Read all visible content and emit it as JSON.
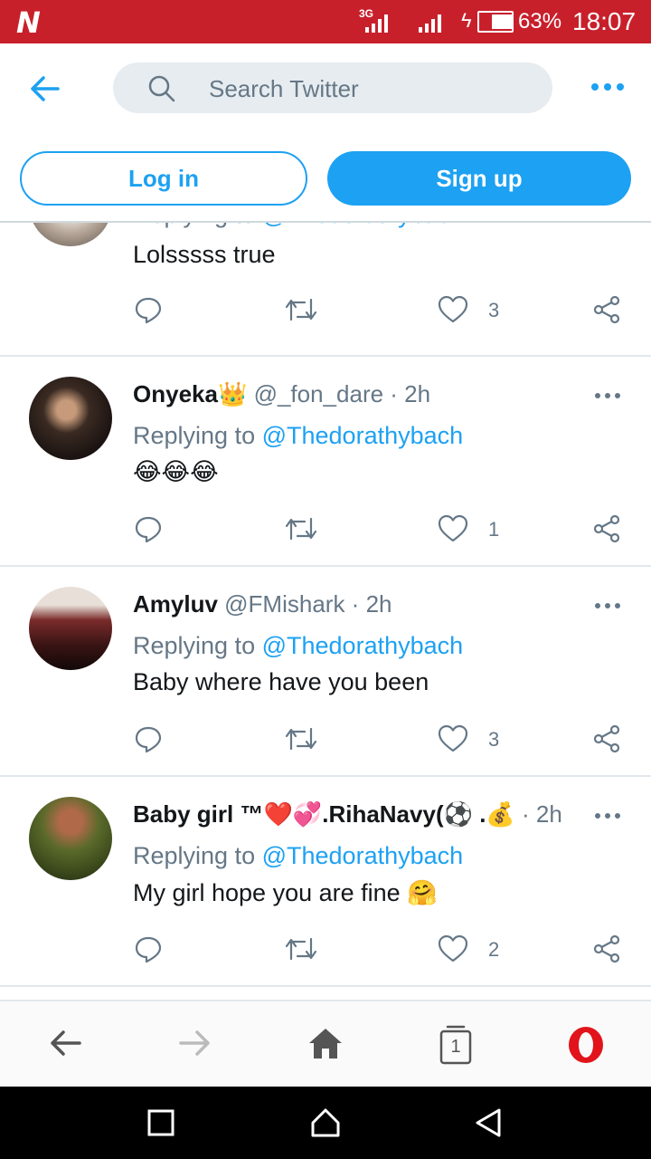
{
  "status_bar": {
    "network": "3G",
    "battery_percent": "63%",
    "time": "18:07"
  },
  "header": {
    "search_placeholder": "Search Twitter",
    "login_label": "Log in",
    "signup_label": "Sign up"
  },
  "tweets": [
    {
      "replying_prefix": "Replying to",
      "replying_handle": "@Thedorathybach",
      "text": "Lolsssss true",
      "likes": "3"
    },
    {
      "name": "Onyeka",
      "name_emoji": "👑",
      "handle": "@_fon_dare",
      "time": "2h",
      "replying_prefix": "Replying to",
      "replying_handle": "@Thedorathybach",
      "text": "😂😂😂",
      "likes": "1"
    },
    {
      "name": "Amyluv",
      "handle": "@FMishark",
      "time": "2h",
      "replying_prefix": "Replying to",
      "replying_handle": "@Thedorathybach",
      "text": "Baby where have you been",
      "likes": "3"
    },
    {
      "name": "Baby girl ™❤️💞.RihaNavy(⚽ .💰",
      "time": "2h",
      "replying_prefix": "Replying to",
      "replying_handle": "@Thedorathybach",
      "text": "My girl hope you are fine 🤗",
      "likes": "2"
    }
  ],
  "browser_nav": {
    "tab_count": "1"
  },
  "colors": {
    "status_bar": "#c8202b",
    "accent": "#1da1f2",
    "opera_red": "#e1141b"
  }
}
